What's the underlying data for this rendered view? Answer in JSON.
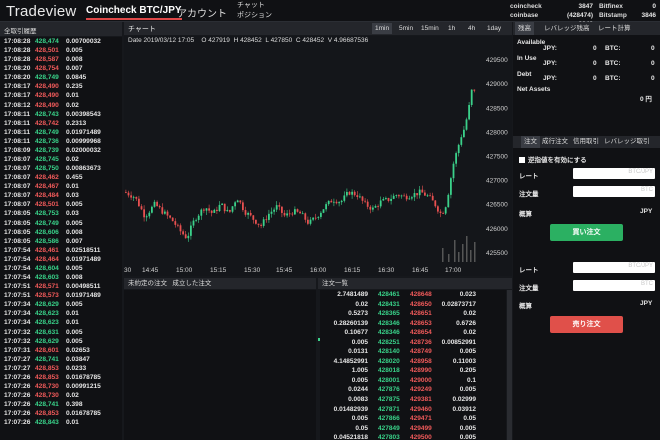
{
  "header": {
    "logo": "Tradeview",
    "tab_main": "Coincheck BTC/JPY",
    "tab_account": "アカウント",
    "chat_line1": "チャット",
    "chat_line2": "ポジション",
    "tickers": [
      {
        "name": "coincheck",
        "price": "3847 (428474)"
      },
      {
        "name": "coinbase",
        "price": "3848"
      },
      {
        "name": "Bitfinex",
        "price": "0"
      },
      {
        "name": "Bitstamp",
        "price": "3846"
      }
    ]
  },
  "left": {
    "title": "全取引履歴",
    "trades": [
      [
        "17:08:28",
        "428,474",
        "0.00700032",
        "up"
      ],
      [
        "17:08:28",
        "428,501",
        "0.005",
        "dn"
      ],
      [
        "17:08:28",
        "428,587",
        "0.008",
        "dn"
      ],
      [
        "17:08:20",
        "428,754",
        "0.007",
        "dn"
      ],
      [
        "17:08:20",
        "428,749",
        "0.0845",
        "up"
      ],
      [
        "17:08:17",
        "428,490",
        "0.235",
        "dn"
      ],
      [
        "17:08:17",
        "428,490",
        "0.01",
        "dn"
      ],
      [
        "17:08:12",
        "428,490",
        "0.02",
        "dn"
      ],
      [
        "17:08:11",
        "428,743",
        "0.00398543",
        "up"
      ],
      [
        "17:08:11",
        "428,742",
        "0.2313",
        "dn"
      ],
      [
        "17:08:11",
        "428,749",
        "0.01971489",
        "up"
      ],
      [
        "17:08:11",
        "428,736",
        "0.00999968",
        "up"
      ],
      [
        "17:08:09",
        "428,739",
        "0.02000032",
        "up"
      ],
      [
        "17:08:07",
        "428,745",
        "0.02",
        "up"
      ],
      [
        "17:08:07",
        "428,750",
        "0.00863673",
        "up"
      ],
      [
        "17:08:07",
        "428,462",
        "0.455",
        "dn"
      ],
      [
        "17:08:07",
        "428,467",
        "0.01",
        "dn"
      ],
      [
        "17:08:07",
        "428,484",
        "0.03",
        "dn"
      ],
      [
        "17:08:07",
        "428,501",
        "0.005",
        "dn"
      ],
      [
        "17:08:05",
        "428,753",
        "0.03",
        "up"
      ],
      [
        "17:08:05",
        "428,749",
        "0.005",
        "up"
      ],
      [
        "17:08:05",
        "428,606",
        "0.008",
        "up"
      ],
      [
        "17:08:05",
        "428,586",
        "0.007",
        "up"
      ],
      [
        "17:07:54",
        "428,461",
        "0.02518511",
        "dn"
      ],
      [
        "17:07:54",
        "428,464",
        "0.01971489",
        "dn"
      ],
      [
        "17:07:54",
        "428,604",
        "0.005",
        "up"
      ],
      [
        "17:07:54",
        "428,603",
        "0.008",
        "up"
      ],
      [
        "17:07:51",
        "428,571",
        "0.00498511",
        "dn"
      ],
      [
        "17:07:51",
        "428,573",
        "0.01971489",
        "dn"
      ],
      [
        "17:07:34",
        "428,629",
        "0.005",
        "up"
      ],
      [
        "17:07:34",
        "428,623",
        "0.01",
        "up"
      ],
      [
        "17:07:34",
        "428,623",
        "0.01",
        "up"
      ],
      [
        "17:07:32",
        "428,631",
        "0.005",
        "up"
      ],
      [
        "17:07:32",
        "428,629",
        "0.005",
        "up"
      ],
      [
        "17:07:31",
        "428,601",
        "0.02653",
        "dn"
      ],
      [
        "17:07:27",
        "428,741",
        "0.03847",
        "up"
      ],
      [
        "17:07:27",
        "428,853",
        "0.0233",
        "dn"
      ],
      [
        "17:07:26",
        "428,853",
        "0.01678785",
        "dn"
      ],
      [
        "17:07:26",
        "428,730",
        "0.00991215",
        "dn"
      ],
      [
        "17:07:26",
        "428,730",
        "0.02",
        "dn"
      ],
      [
        "17:07:26",
        "428,741",
        "0.398",
        "up"
      ],
      [
        "17:07:26",
        "428,853",
        "0.01678785",
        "dn"
      ],
      [
        "17:07:26",
        "428,843",
        "0.01",
        "up"
      ]
    ]
  },
  "chart": {
    "title": "チャート",
    "timeframes": [
      "1min",
      "5min",
      "15min",
      "1h",
      "4h",
      "1day"
    ],
    "active_timeframe": "1min",
    "info_date": "Date 2019/03/12 17:05",
    "info_o": "O 427919",
    "info_h": "H 428452",
    "info_l": "L 427850",
    "info_c": "C 428452",
    "info_v": "V 4.96687536",
    "y_ticks": [
      "429500",
      "429000",
      "428500",
      "428000",
      "427500",
      "427000",
      "426500",
      "426000",
      "425500"
    ],
    "x_ticks": [
      "30",
      "14:45",
      "15:00",
      "15:15",
      "15:30",
      "15:45",
      "16:00",
      "16:15",
      "16:30",
      "16:45",
      "17:00"
    ]
  },
  "mid": {
    "pending_label": "未約定の注文",
    "filled_label": "成立した注文",
    "orders_label": "注文一覧",
    "orders": [
      [
        "2.7481489",
        "428461",
        "428648",
        "0.023"
      ],
      [
        "0.02",
        "428431",
        "428650",
        "0.02873717"
      ],
      [
        "0.5273",
        "428365",
        "428651",
        "0.02"
      ],
      [
        "0.28260139",
        "428346",
        "428653",
        "0.6726"
      ],
      [
        "0.10677",
        "428346",
        "428654",
        "0.02"
      ],
      [
        "0.005",
        "428251",
        "428736",
        "0.00852991"
      ],
      [
        "0.0131",
        "428140",
        "428749",
        "0.005"
      ],
      [
        "4.14852991",
        "428020",
        "428958",
        "0.11003"
      ],
      [
        "1.005",
        "428018",
        "428990",
        "0.205"
      ],
      [
        "0.005",
        "428001",
        "429000",
        "0.1"
      ],
      [
        "0.0244",
        "427876",
        "429249",
        "0.005"
      ],
      [
        "0.0083",
        "427875",
        "429381",
        "0.02999"
      ],
      [
        "0.01482939",
        "427871",
        "429460",
        "0.03912"
      ],
      [
        "0.005",
        "427866",
        "429471",
        "0.05"
      ],
      [
        "0.05",
        "427849",
        "429499",
        "0.005"
      ],
      [
        "0.04521818",
        "427803",
        "429500",
        "0.005"
      ]
    ]
  },
  "right": {
    "tabs": [
      "残高",
      "レバレッジ残高",
      "レート計算"
    ],
    "available": "Available",
    "in_use": "In Use",
    "debt": "Debt",
    "net_assets": "Net Assets",
    "jpy": "JPY:",
    "btc": "BTC:",
    "zero": "0",
    "net_value": "0 円",
    "order_tabs": [
      "注文",
      "成行注文",
      "信用取引",
      "レバレッジ取引"
    ],
    "reverse_label": "逆指値を有効にする",
    "rate": "レート",
    "amount": "注文量",
    "estimate": "概算",
    "unit_jpy": "JPY",
    "ph_rate": "BTC/JPY",
    "ph_amount": "BTC",
    "buy": "買い注文",
    "sell": "売り注文"
  },
  "colors": {
    "up": "#39d38a",
    "down": "#f05a5a",
    "buy": "#2bb062",
    "sell": "#e0504a"
  }
}
